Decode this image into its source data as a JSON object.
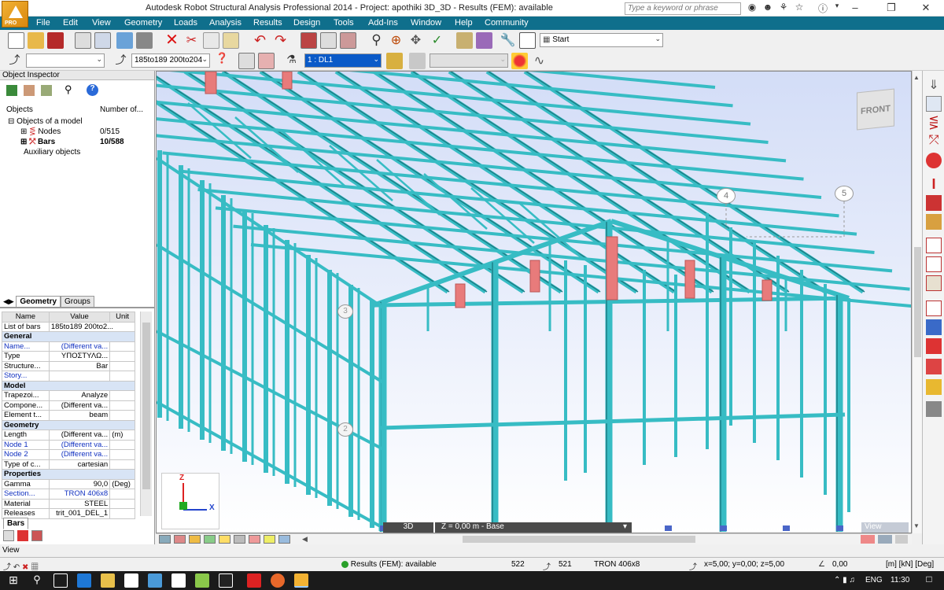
{
  "app": {
    "title": "Autodesk Robot Structural Analysis Professional 2014 - Project: apothiki 3D_3D - Results (FEM): available",
    "logo_text": "PRO",
    "search_placeholder": "Type a keyword or phrase"
  },
  "menu": [
    "File",
    "Edit",
    "View",
    "Geometry",
    "Loads",
    "Analysis",
    "Results",
    "Design",
    "Tools",
    "Add-Ins",
    "Window",
    "Help",
    "Community"
  ],
  "toolbar": {
    "layout_combo": "Start",
    "selection_combo": "185to189 200to204",
    "case_combo": "1 : DL1",
    "blank_combo": "",
    "disabled_combo": ""
  },
  "object_inspector": {
    "title": "Object Inspector",
    "col_objects": "Objects",
    "col_number": "Number of...",
    "root": "Objects of a model",
    "items": [
      {
        "label": "Nodes",
        "count": "0/515"
      },
      {
        "label": "Bars",
        "count": "10/588"
      }
    ],
    "aux": "Auxiliary objects",
    "tabs": [
      "Geometry",
      "Groups"
    ]
  },
  "properties": {
    "headers": [
      "Name",
      "Value",
      "Unit"
    ],
    "list_label": "List of bars",
    "list_value": "185to189 200to2...",
    "sections": [
      {
        "title": "General",
        "rows": [
          {
            "name": "Name...",
            "value": "(Different va...",
            "unit": "",
            "blue": true
          },
          {
            "name": "Type",
            "value": "ΥΠΟΣΤΥΛΩ...",
            "unit": ""
          },
          {
            "name": "Structure...",
            "value": "Bar",
            "unit": ""
          },
          {
            "name": "Story...",
            "value": "",
            "unit": "",
            "blue": true
          }
        ]
      },
      {
        "title": "Model",
        "rows": [
          {
            "name": "Trapezoi...",
            "value": "Analyze",
            "unit": ""
          },
          {
            "name": "Compone...",
            "value": "(Different va...",
            "unit": ""
          },
          {
            "name": "Element t...",
            "value": "beam",
            "unit": ""
          }
        ]
      },
      {
        "title": "Geometry",
        "rows": [
          {
            "name": "Length",
            "value": "(Different va...",
            "unit": "(m)"
          },
          {
            "name": "Node 1",
            "value": "(Different va...",
            "unit": "",
            "blue": true
          },
          {
            "name": "Node 2",
            "value": "(Different va...",
            "unit": "",
            "blue": true
          },
          {
            "name": "Type of c...",
            "value": "cartesian",
            "unit": ""
          }
        ]
      },
      {
        "title": "Properties",
        "rows": [
          {
            "name": "Gamma",
            "value": "90,0",
            "unit": "(Deg)"
          },
          {
            "name": "Section...",
            "value": "TRON 406x8",
            "unit": "",
            "blue": true
          },
          {
            "name": "Material",
            "value": "STEEL",
            "unit": ""
          },
          {
            "name": "Releases",
            "value": "trit_001_DEL_1",
            "unit": ""
          }
        ]
      }
    ],
    "bottom_tab": "Bars"
  },
  "viewport": {
    "view_cube": "FRONT",
    "axis_labels": [
      "4",
      "5",
      "3",
      "2"
    ],
    "mode_button": "3D",
    "level_label": "Z = 0,00 m - Base",
    "view_label": "View",
    "triad": {
      "x": "X",
      "z": "Z"
    },
    "colors": {
      "structure": "#37bcc4",
      "structure_dark": "#1d7f86",
      "column_highlight": "#e87b7b",
      "bg_top": "#d5dff8",
      "bg_bottom": "#ffffff"
    }
  },
  "view_tab": "View",
  "status": {
    "results": "Results (FEM): available",
    "node_a": "522",
    "node_b": "521",
    "section": "TRON 406x8",
    "coords": "x=5,00; y=0,00; z=5,00",
    "angle": "0,00",
    "units": "[m] [kN] [Deg]"
  },
  "taskbar": {
    "lang": "ENG",
    "time": "11:30"
  }
}
